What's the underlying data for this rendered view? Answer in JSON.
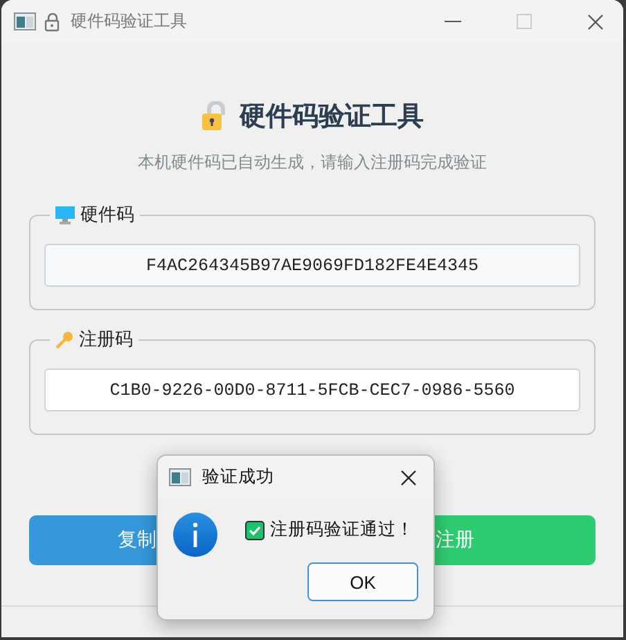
{
  "window": {
    "title": "硬件码验证工具"
  },
  "header": {
    "title": "硬件码验证工具",
    "subtitle": "本机硬件码已自动生成，请输入注册码完成验证"
  },
  "groups": [
    {
      "kind": "hardware",
      "label": "硬件码",
      "value": "F4AC264345B97AE9069FD182FE4E4345"
    },
    {
      "kind": "registration",
      "label": "注册码",
      "value": "C1B0-9226-00D0-8711-5FCB-CEC7-0986-5560"
    }
  ],
  "buttons": [
    {
      "kind": "copy",
      "label": "复制"
    },
    {
      "kind": "register",
      "label": "注册"
    }
  ],
  "dialog": {
    "title": "验证成功",
    "message": "注册码验证通过！",
    "ok": "OK"
  }
}
